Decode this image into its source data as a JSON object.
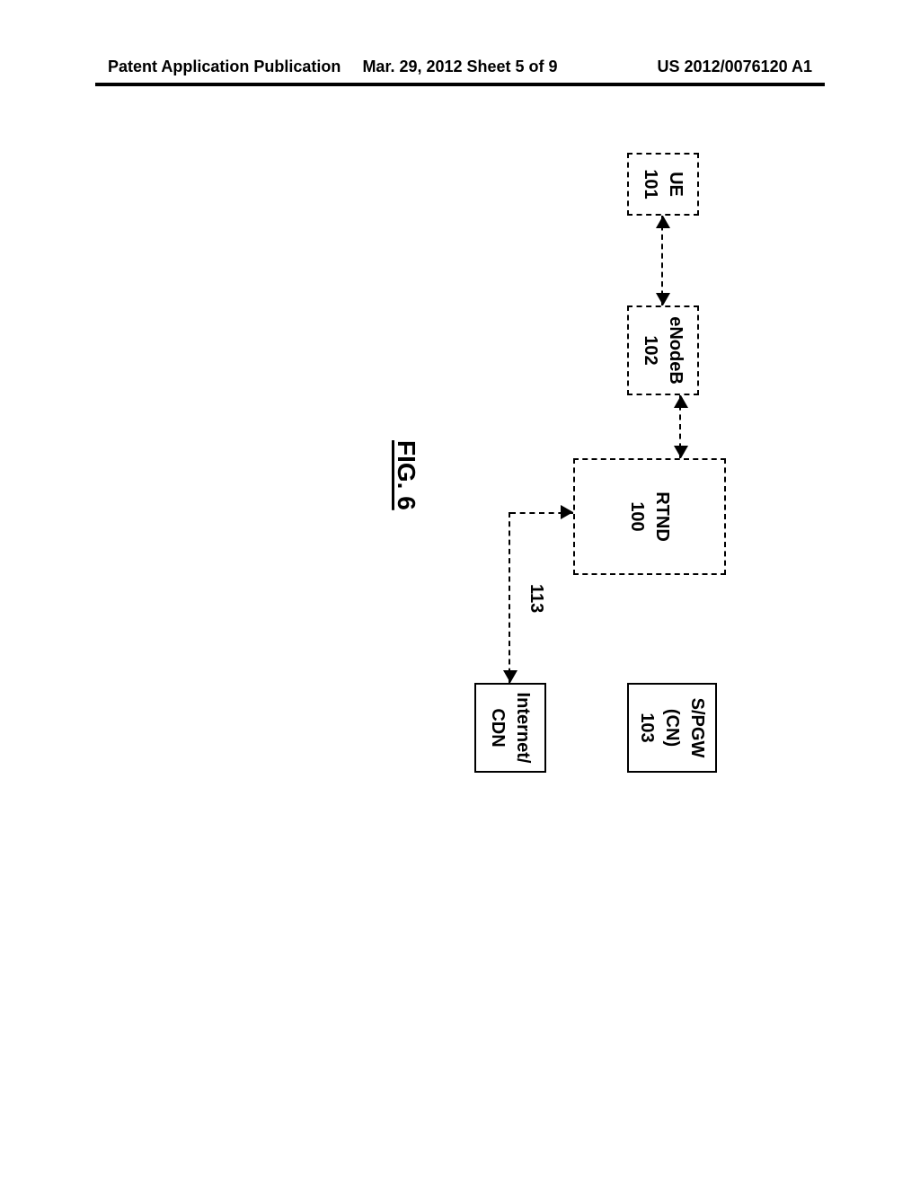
{
  "header": {
    "left": "Patent Application Publication",
    "center": "Mar. 29, 2012  Sheet 5 of 9",
    "right": "US 2012/0076120 A1"
  },
  "boxes": {
    "ue": {
      "line1": "UE",
      "line2": "101"
    },
    "enodeb": {
      "line1": "eNodeB",
      "line2": "102"
    },
    "rtnd": {
      "line1": "RTND",
      "line2": "100"
    },
    "spgw": {
      "line1": "S/PGW",
      "line2": "(CN)",
      "line3": "103"
    },
    "internet": {
      "line1": "Internet/",
      "line2": "CDN"
    }
  },
  "connectors": {
    "rtnd_internet_label": "113"
  },
  "figure_label": "FIG. 6"
}
